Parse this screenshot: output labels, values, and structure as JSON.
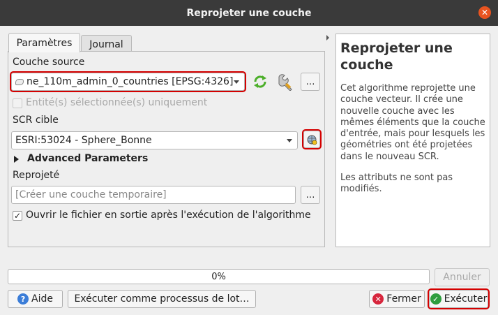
{
  "window": {
    "title": "Reprojeter une couche"
  },
  "tabs": [
    {
      "label": "Paramètres"
    },
    {
      "label": "Journal"
    }
  ],
  "params": {
    "source_label": "Couche source",
    "source_value": "ne_110m_admin_0_countries [EPSG:4326]",
    "selected_only_label": "Entité(s) sélectionnée(s) uniquement",
    "selected_only_checked": false,
    "crs_label": "SCR cible",
    "crs_value": "ESRI:53024 - Sphere_Bonne",
    "advanced_label": "Advanced Parameters",
    "output_label": "Reprojeté",
    "output_placeholder": "[Créer une couche temporaire]",
    "open_after_label": "Ouvrir le fichier en sortie après l'exécution de l'algorithme",
    "open_after_checked": true,
    "browse_label": "…"
  },
  "help": {
    "title": "Reprojeter une couche",
    "paragraph1": "Cet algorithme reprojette une couche vecteur. Il crée une nouvelle couche avec les mêmes éléments que la couche d'entrée, mais pour lesquels les géométries ont été projetées dans le nouveau SCR.",
    "paragraph2": "Les attributs ne sont pas modifiés."
  },
  "progress": {
    "text": "0%",
    "value": 0
  },
  "buttons": {
    "cancel": "Annuler",
    "help": "Aide",
    "batch": "Exécuter comme processus de lot…",
    "close": "Fermer",
    "run": "Exécuter"
  },
  "colors": {
    "highlight": "#d40000",
    "accent": "#e95420",
    "help_icon": "#3b7dd8",
    "close_icon": "#d7263d",
    "run_icon": "#2e9e3f"
  }
}
